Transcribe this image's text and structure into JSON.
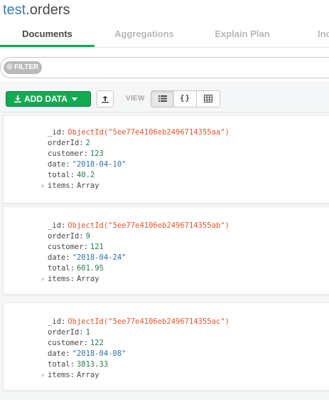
{
  "header": {
    "database": "test",
    "collection": ".orders"
  },
  "tabs": [
    {
      "label": "Documents"
    },
    {
      "label": "Aggregations"
    },
    {
      "label": "Explain Plan"
    },
    {
      "label": "Inc"
    }
  ],
  "filter": {
    "label": "FILTER"
  },
  "toolbar": {
    "add_data_label": "ADD DATA",
    "view_label": "VIEW",
    "view_json_glyph": "{}"
  },
  "documents": [
    {
      "_id": "ObjectId(\"5ee77e4106eb2496714355aa\")",
      "orderId": "2",
      "customer": "123",
      "date": "\"2018-04-10\"",
      "total": "40.2",
      "items": "Array"
    },
    {
      "_id": "ObjectId(\"5ee77e4106eb2496714355ab\")",
      "orderId": "9",
      "customer": "121",
      "date": "\"2018-04-24\"",
      "total": "601.95",
      "items": "Array"
    },
    {
      "_id": "ObjectId(\"5ee77e4106eb2496714355ac\")",
      "orderId": "1",
      "customer": "122",
      "date": "\"2018-04-08\"",
      "total": "3813.33",
      "items": "Array"
    }
  ],
  "field_names": {
    "id": "_id",
    "orderId": "orderId",
    "customer": "customer",
    "date": "date",
    "total": "total",
    "items": "items"
  },
  "colors": {
    "accent_green": "#13aa52",
    "database_blue": "#3f7eb3",
    "objectid_orange": "#e8562b",
    "number_green": "#277a4a",
    "string_blue": "#2f6fa6"
  },
  "icons": {
    "add_data": "download-icon",
    "dropdown": "caret-down-icon",
    "export": "upload-icon",
    "list_view": "list-icon",
    "json_view": "braces-icon",
    "table_view": "table-icon",
    "expand": "chevron-right-icon"
  }
}
